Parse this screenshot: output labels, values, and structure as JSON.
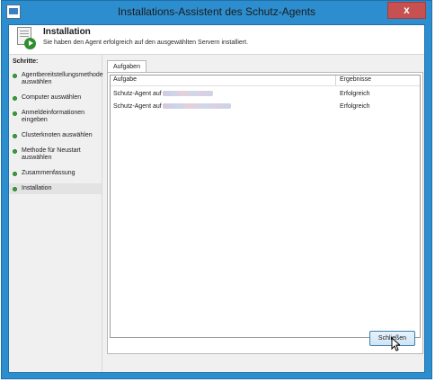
{
  "window": {
    "title": "Installations-Assistent des Schutz-Agents",
    "close_glyph": "x"
  },
  "header": {
    "title": "Installation",
    "subtitle": "Sie haben den Agent erfolgreich auf den ausgewählten Servern installiert."
  },
  "sidebar": {
    "title": "Schritte:",
    "steps": [
      "Agentbereitstellungsmethode auswählen",
      "Computer auswählen",
      "Anmeldeinformationen eingeben",
      "Clusterknoten auswählen",
      "Methode für Neustart auswählen",
      "Zusammenfassung",
      "Installation"
    ]
  },
  "tabs": [
    "Aufgaben"
  ],
  "grid": {
    "columns": [
      "Aufgabe",
      "Ergebnisse"
    ],
    "rows": [
      {
        "task": "Schutz-Agent auf",
        "result": "Erfolgreich"
      },
      {
        "task": "Schutz-Agent auf",
        "result": "Erfolgreich"
      }
    ]
  },
  "buttons": {
    "close": "Schließen"
  },
  "colors": {
    "titlebar": "#2d8ecf",
    "step_dot": "#37a337",
    "close_button": "#c75050"
  }
}
